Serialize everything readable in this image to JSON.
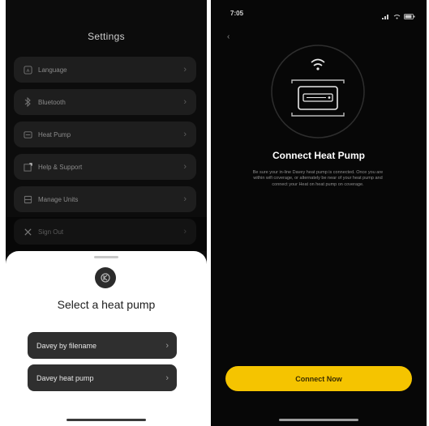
{
  "settings": {
    "title": "Settings",
    "items": [
      {
        "label": "Language",
        "icon": "globe-icon"
      },
      {
        "label": "Bluetooth",
        "icon": "bluetooth-icon"
      },
      {
        "label": "Heat Pump",
        "icon": "heat-pump-icon"
      },
      {
        "label": "Help & Support",
        "icon": "help-icon"
      },
      {
        "label": "Manage Units",
        "icon": "units-icon"
      },
      {
        "label": "Sign Out",
        "icon": "close-icon"
      }
    ]
  },
  "sheet": {
    "title": "Select a heat pump",
    "options": [
      {
        "label": "Davey by filename"
      },
      {
        "label": "Davey heat pump"
      }
    ]
  },
  "connect": {
    "status_time": "7:05",
    "title": "Connect Heat Pump",
    "description": "Be sure your in-line Davey heat pump is connected. Once you are within wifi coverage, or alternately be near of your heat pump and connect your Heat on heat pump on coverage.",
    "button_label": "Connect Now"
  },
  "colors": {
    "accent": "#f5c400",
    "background": "#070707"
  }
}
